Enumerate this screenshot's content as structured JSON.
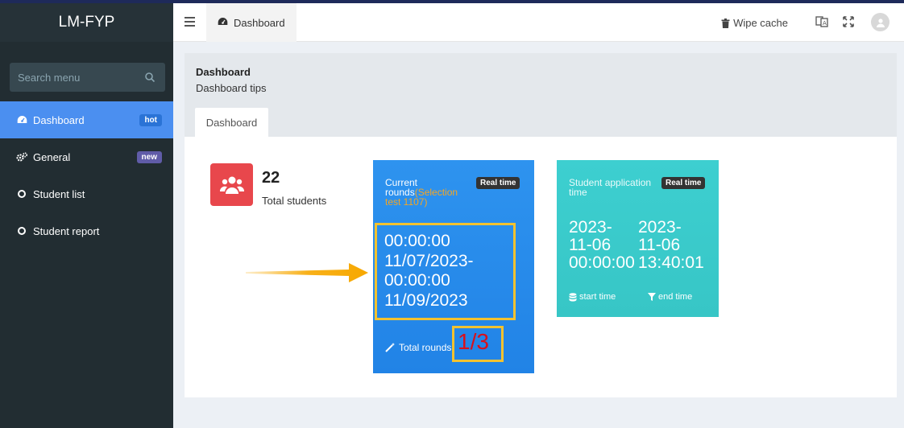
{
  "brand": "LM-FYP",
  "search": {
    "placeholder": "Search menu"
  },
  "sidebar": {
    "items": [
      {
        "label": "Dashboard",
        "badge": "hot"
      },
      {
        "label": "General",
        "badge": "new"
      },
      {
        "label": "Student list"
      },
      {
        "label": "Student report"
      }
    ]
  },
  "header": {
    "tab": "Dashboard",
    "wipe_cache": "Wipe cache"
  },
  "page": {
    "title": "Dashboard",
    "subtitle": "Dashboard tips",
    "tab": "Dashboard"
  },
  "stats": {
    "total_students": "22",
    "total_students_label": "Total students"
  },
  "card_rounds": {
    "title": "Current rounds",
    "selection": "(Selection test 1107)",
    "badge": "Real time",
    "time_line1": "00:00:00",
    "time_line2": "11/07/2023-",
    "time_line3": "00:00:00",
    "time_line4": "11/09/2023",
    "footer": "Total rounds",
    "ratio": "1/3"
  },
  "card_application": {
    "title": "Student application time",
    "badge": "Real time",
    "start_line1": "2023-",
    "start_line2": "11-06",
    "start_line3": "00:00:00",
    "end_line1": "2023-",
    "end_line2": "11-06",
    "end_line3": "13:40:01",
    "start_label": "start time",
    "end_label": "end time"
  },
  "colors": {
    "sidebar_bg": "#222d32",
    "active_menu": "#4b8ff0",
    "card_blue": "#2e93ef",
    "card_teal": "#3dcfd0",
    "stat_red": "#e8474c",
    "highlight_yellow": "#f2c230",
    "ratio_red": "#d9101a",
    "arrow_orange": "#f7a800"
  }
}
